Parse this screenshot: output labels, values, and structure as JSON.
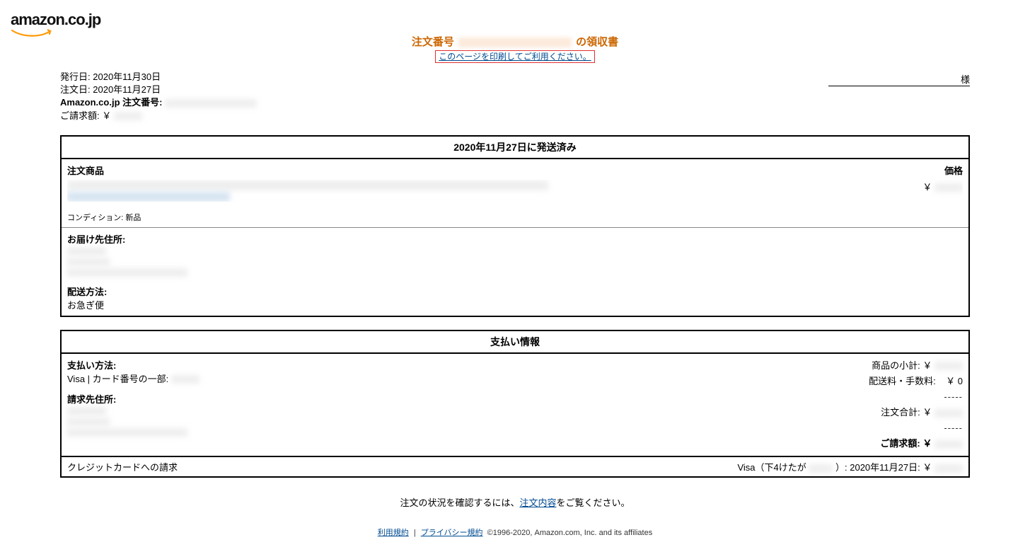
{
  "logo_text": "amazon.co.jp",
  "header": {
    "prefix": "注文番号",
    "suffix": "の領収書",
    "print_link": "このページを印刷してご利用ください。"
  },
  "name_suffix": "様",
  "meta": {
    "issue_label": "発行日:",
    "issue_value": "2020年11月30日",
    "order_label": "注文日:",
    "order_value": "2020年11月27日",
    "ordernum_label": "Amazon.co.jp 注文番号:",
    "billed_label": "ご請求額:",
    "billed_currency": "￥"
  },
  "shipment": {
    "header": "2020年11月27日に発送済み",
    "items_label": "注文商品",
    "price_label": "価格",
    "price_currency": "￥",
    "condition_label": "コンディション:",
    "condition_value": "新品",
    "shipto_label": "お届け先住所:",
    "method_label": "配送方法:",
    "method_value": "お急ぎ便"
  },
  "payment": {
    "header": "支払い情報",
    "method_label": "支払い方法:",
    "method_value": "Visa | カード番号の一部:",
    "billto_label": "請求先住所:",
    "subtotal_label": "商品の小計:",
    "subtotal_cur": "￥",
    "shipping_label": "配送料・手数料:",
    "shipping_value": "￥ 0",
    "dashes": "-----",
    "ordertotal_label": "注文合計:",
    "ordertotal_cur": "￥",
    "grandtotal_label": "ご請求額:",
    "grandtotal_cur": "￥"
  },
  "cc_charge": {
    "label": "クレジットカードへの請求",
    "right_prefix": "Visa（下4けたが",
    "right_mid": "）: 2020年11月27日:",
    "right_cur": "￥"
  },
  "footer_check": {
    "before": "注文の状況を確認するには、",
    "link": "注文内容",
    "after": "をご覧ください。"
  },
  "footer_legal": {
    "tos": "利用規約",
    "privacy": "プライバシー規約",
    "copyright": "©1996-2020, Amazon.com, Inc. and its affiliates"
  }
}
